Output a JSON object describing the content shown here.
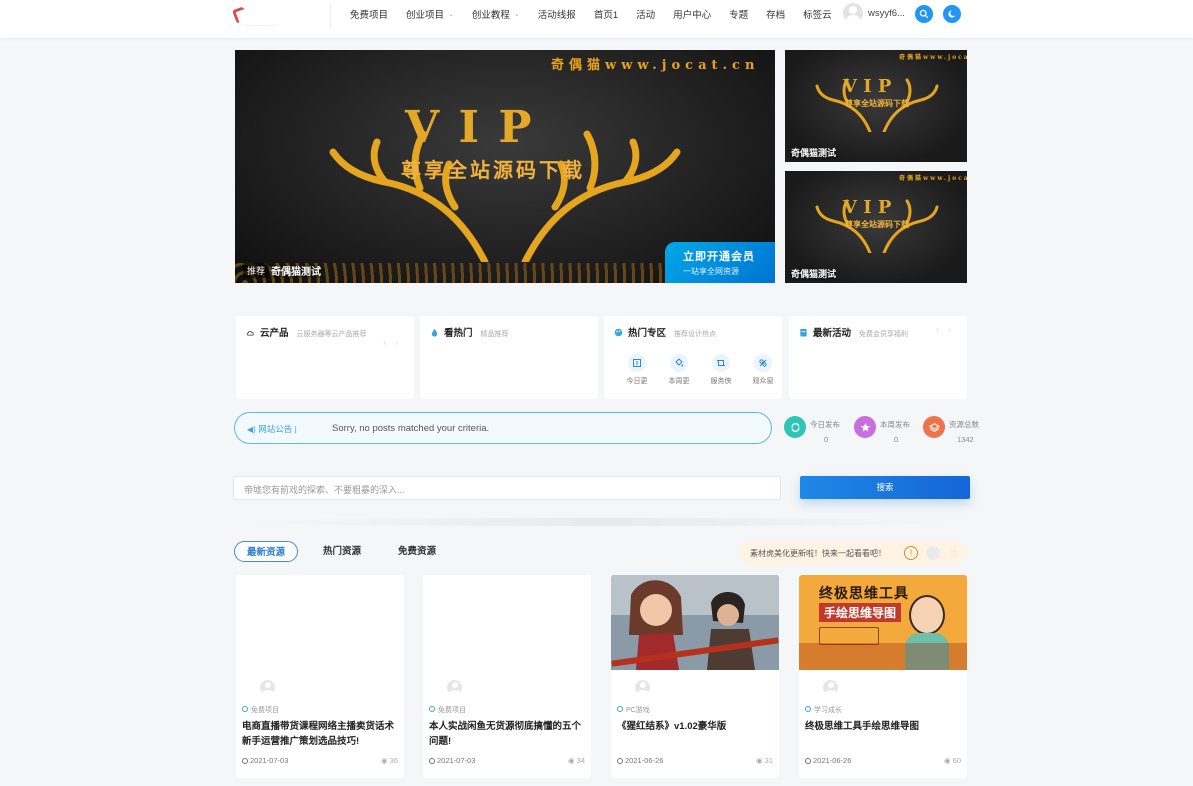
{
  "header": {
    "nav": [
      {
        "label": "免费项目",
        "has_caret": false
      },
      {
        "label": "创业项目",
        "has_caret": true
      },
      {
        "label": "创业教程",
        "has_caret": true
      },
      {
        "label": "活动线报",
        "has_caret": false
      },
      {
        "label": "首页1",
        "has_caret": false
      },
      {
        "label": "活动",
        "has_caret": false
      },
      {
        "label": "用户中心",
        "has_caret": false
      },
      {
        "label": "专题",
        "has_caret": false
      },
      {
        "label": "存档",
        "has_caret": false
      },
      {
        "label": "标签云",
        "has_caret": false
      }
    ],
    "user_name": "wsyyf6...",
    "search_icon": "search-icon",
    "theme_icon": "moon-icon"
  },
  "banner": {
    "main": {
      "url_text": "奇偶猫www.jocat.cn",
      "vip": "V I P",
      "subtitle": "尊享全站源码下载",
      "badge": "推荐",
      "caption": "奇偶猫测试",
      "cta_line1": "立即开通会员",
      "cta_line2": "一站享全网资源"
    },
    "side": [
      {
        "url_text": "奇偶猫www.jocat",
        "vip": "V I P",
        "subtitle": "尊享全站源码下载",
        "caption": "奇偶猫测试"
      },
      {
        "url_text": "奇偶猫www.jocat",
        "vip": "V I P",
        "subtitle": "尊享全站源码下载",
        "caption": "奇偶猫测试"
      }
    ]
  },
  "cards": [
    {
      "icon": "cloud-icon",
      "title": "云产品",
      "sub": "云服务器等云产品推荐",
      "pager": "‹ ›"
    },
    {
      "icon": "flame-icon",
      "title": "看热门",
      "sub": "精品推荐",
      "pager": ""
    },
    {
      "icon": "palette-icon",
      "title": "热门专区",
      "sub": "推荐设计热点",
      "pager": "",
      "items": [
        {
          "icon": "today-icon",
          "label": "今日更"
        },
        {
          "icon": "bucket-icon",
          "label": "本周更"
        },
        {
          "icon": "crop-icon",
          "label": "服务侠"
        },
        {
          "icon": "link-icon",
          "label": "观众窗"
        }
      ]
    },
    {
      "icon": "calendar-icon",
      "title": "最新活动",
      "sub": "免费会员享福利",
      "pager": "‹ ›"
    }
  ],
  "notice": {
    "label": "网站公告 |",
    "text": "Sorry, no posts matched your criteria."
  },
  "stats": [
    {
      "icon": "refresh-icon",
      "label": "今日发布",
      "value": "0",
      "color": "#2ec4b6"
    },
    {
      "icon": "star-icon",
      "label": "本周发布",
      "value": "0",
      "color": "#c86ee0"
    },
    {
      "icon": "layers-icon",
      "label": "资源总数",
      "value": "1342",
      "color": "#f0724a"
    }
  ],
  "search": {
    "placeholder": "帝墟您有前戏的探索、不要粗暴的深入...",
    "button": "搜索"
  },
  "tabs": [
    {
      "label": "最新资源",
      "active": true
    },
    {
      "label": "热门资源",
      "active": false
    },
    {
      "label": "免费资源",
      "active": false
    }
  ],
  "promo": {
    "text": "素材虎美化更新啦！快来一起看看吧！"
  },
  "posts": [
    {
      "category": "免费项目",
      "title": "电商直播带货课程网络主播卖货话术新手运营推广策划选品技巧!",
      "date": "2021-07-03",
      "views": "36",
      "thumb": "none"
    },
    {
      "category": "免费项目",
      "title": "本人实战闲鱼无货源彻底搞懂的五个问题!",
      "date": "2021-07-03",
      "views": "34",
      "thumb": "none"
    },
    {
      "category": "PC游戏",
      "title": "《猩红结系》v1.02豪华版",
      "date": "2021-06-26",
      "views": "31",
      "thumb": "game"
    },
    {
      "category": "学习成长",
      "title": "终极思维工具手绘思维导图",
      "date": "2021-06-26",
      "views": "60",
      "thumb": "mindmap",
      "thumb_text_1": "终极思维工具",
      "thumb_text_2": "手绘思维导图"
    }
  ],
  "colors": {
    "accent": "#1e88e5",
    "gold": "#e4a828",
    "page_bg": "#f5f6f7"
  }
}
